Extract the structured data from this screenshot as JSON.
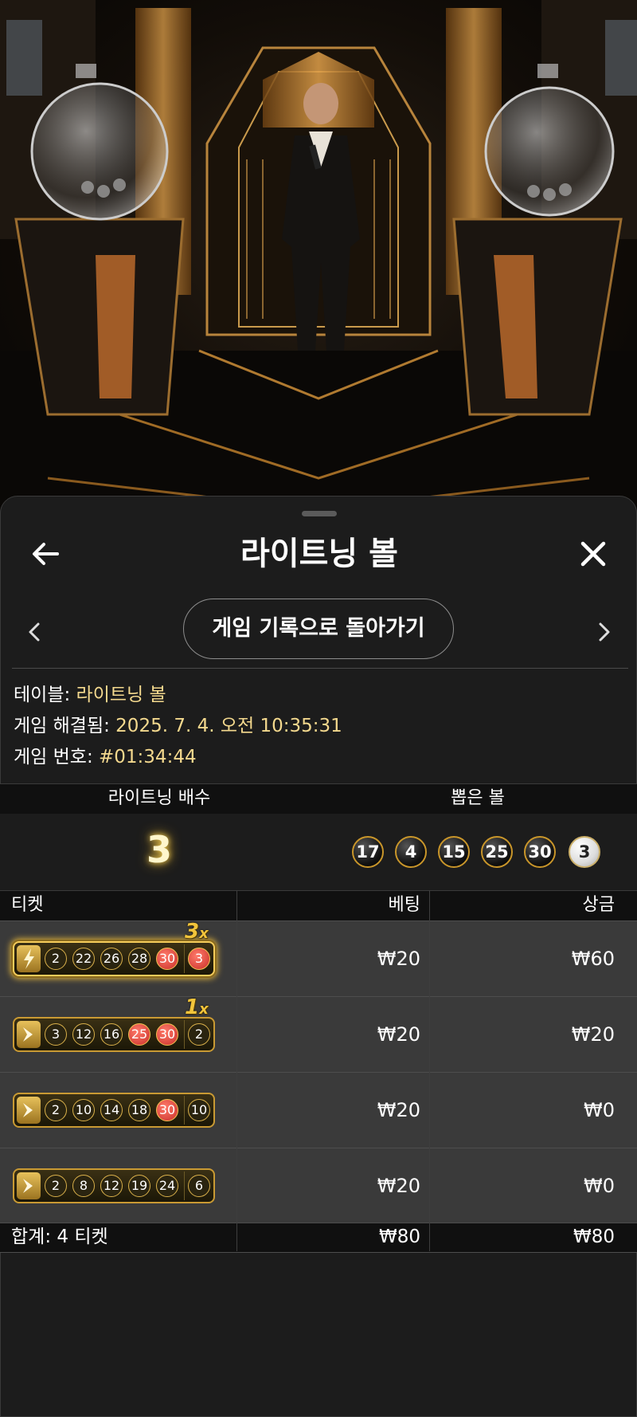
{
  "header": {
    "title": "라이트닝 볼"
  },
  "history_button": {
    "label": "게임 기록으로 돌아가기"
  },
  "info": {
    "table_label": "테이블: ",
    "table_value": "라이트닝 볼",
    "resolved_label": "게임 해결됨: ",
    "resolved_value": "2025. 7. 4. 오전 10:35:31",
    "game_no_label": "게임 번호: ",
    "game_no_value": "#01:34:44"
  },
  "draw": {
    "multiplier_header": "라이트닝 배수",
    "balls_header": "뽑은 볼",
    "multiplier": "3",
    "balls": [
      "17",
      "4",
      "15",
      "25",
      "30"
    ],
    "bonus_ball": "3"
  },
  "table": {
    "col_ticket": "티켓",
    "col_bet": "베팅",
    "col_win": "상금",
    "rows": [
      {
        "balls": [
          "2",
          "22",
          "26",
          "28",
          "30"
        ],
        "bonus": "3",
        "hits": [
          false,
          false,
          false,
          false,
          true
        ],
        "bonus_hit": true,
        "badge": "3",
        "badge_suffix": "x",
        "bet": "₩20",
        "win": "₩60"
      },
      {
        "balls": [
          "3",
          "12",
          "16",
          "25",
          "30"
        ],
        "bonus": "2",
        "hits": [
          false,
          false,
          false,
          true,
          true
        ],
        "bonus_hit": false,
        "badge": "1",
        "badge_suffix": "x",
        "bet": "₩20",
        "win": "₩20"
      },
      {
        "balls": [
          "2",
          "10",
          "14",
          "18",
          "30"
        ],
        "bonus": "10",
        "hits": [
          false,
          false,
          false,
          false,
          true
        ],
        "bonus_hit": false,
        "badge": "",
        "badge_suffix": "",
        "bet": "₩20",
        "win": "₩0"
      },
      {
        "balls": [
          "2",
          "8",
          "12",
          "19",
          "24"
        ],
        "bonus": "6",
        "hits": [
          false,
          false,
          false,
          false,
          false
        ],
        "bonus_hit": false,
        "badge": "",
        "badge_suffix": "",
        "bet": "₩20",
        "win": "₩0"
      }
    ],
    "total_label": "합계: 4 티켓",
    "total_bet": "₩80",
    "total_win": "₩80"
  },
  "colors": {
    "accent_gold": "#f4d98e",
    "hit_red": "#d9382f",
    "panel": "#1c1c1c",
    "row": "#3a3a3a"
  }
}
